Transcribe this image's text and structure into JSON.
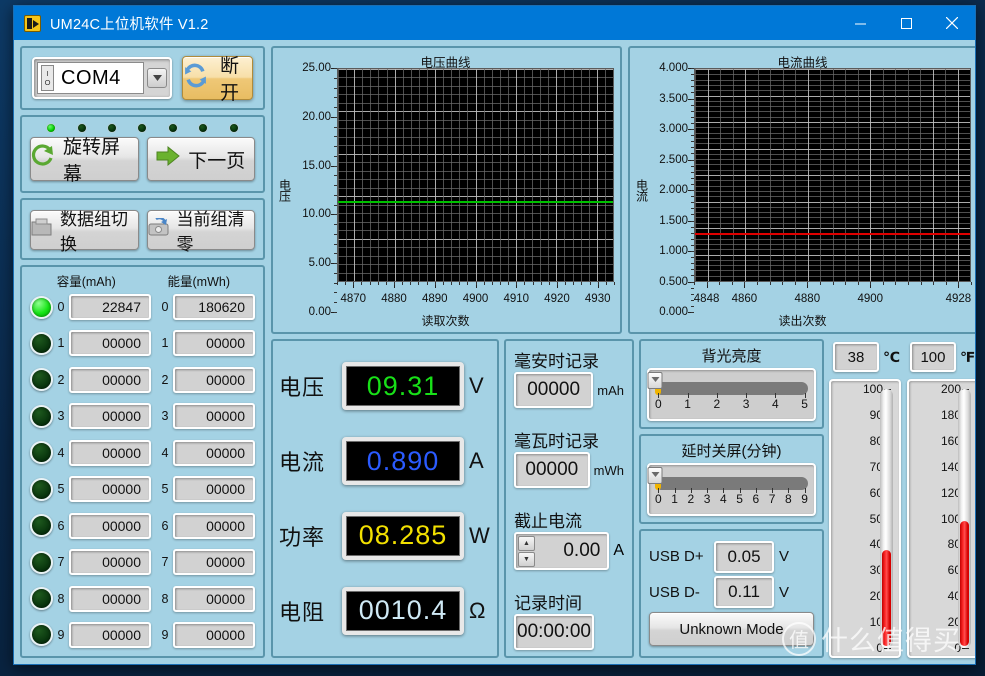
{
  "window": {
    "title": "UM24C上位机软件 V1.2",
    "icon": "labview-vi-icon",
    "minimize": "–",
    "maximize": "□",
    "close": "✕"
  },
  "connection": {
    "port_value": "COM4",
    "port_icon": "io-refnum-icon",
    "dropdown_icon": "chevron-down-icon",
    "disconnect_label": "断开",
    "disconnect_icon": "refresh-icon"
  },
  "leds": {
    "states": [
      "on",
      "off",
      "off",
      "off",
      "off",
      "off",
      "off"
    ]
  },
  "nav": {
    "rotate_label": "旋转屏幕",
    "rotate_icon": "rotate-icon",
    "next_label": "下一页",
    "next_icon": "arrow-right-icon"
  },
  "group": {
    "switch_label": "数据组切换",
    "switch_icon": "folder-icon",
    "clear_label": "当前组清零",
    "clear_icon": "save-clear-icon"
  },
  "list": {
    "header_capacity": "容量(mAh)",
    "header_energy": "能量(mWh)",
    "rows": [
      {
        "index": "0",
        "led": "on",
        "capacity": "22847",
        "energy": "180620"
      },
      {
        "index": "1",
        "led": "off",
        "capacity": "00000",
        "energy": "00000"
      },
      {
        "index": "2",
        "led": "off",
        "capacity": "00000",
        "energy": "00000"
      },
      {
        "index": "3",
        "led": "off",
        "capacity": "00000",
        "energy": "00000"
      },
      {
        "index": "4",
        "led": "off",
        "capacity": "00000",
        "energy": "00000"
      },
      {
        "index": "5",
        "led": "off",
        "capacity": "00000",
        "energy": "00000"
      },
      {
        "index": "6",
        "led": "off",
        "capacity": "00000",
        "energy": "00000"
      },
      {
        "index": "7",
        "led": "off",
        "capacity": "00000",
        "energy": "00000"
      },
      {
        "index": "8",
        "led": "off",
        "capacity": "00000",
        "energy": "00000"
      },
      {
        "index": "9",
        "led": "off",
        "capacity": "00000",
        "energy": "00000"
      }
    ]
  },
  "chart_data": [
    {
      "type": "line",
      "id": "voltage",
      "title": "电压曲线",
      "xlabel": "读取次数",
      "ylabel": "电压",
      "ylim": [
        0,
        25
      ],
      "yticks": [
        "0.00",
        "5.00",
        "10.00",
        "15.00",
        "20.00",
        "25.00"
      ],
      "ytick_values": [
        0,
        5,
        10,
        15,
        20,
        25
      ],
      "xlim": [
        4866,
        4934
      ],
      "xticks": [
        "4870",
        "4880",
        "4890",
        "4900",
        "4910",
        "4920",
        "4930"
      ],
      "xtick_values": [
        4870,
        4880,
        4890,
        4900,
        4910,
        4920,
        4930
      ],
      "grid": true,
      "series": [
        {
          "name": "电压",
          "color": "#00c000",
          "constant_value": 9.31
        }
      ]
    },
    {
      "type": "line",
      "id": "current",
      "title": "电流曲线",
      "xlabel": "读出次数",
      "ylabel": "电流",
      "ylim": [
        0,
        4
      ],
      "yticks": [
        "0.000",
        "0.500",
        "1.000",
        "1.500",
        "2.000",
        "2.500",
        "3.000",
        "3.500",
        "4.000"
      ],
      "ytick_values": [
        0,
        0.5,
        1.0,
        1.5,
        2.0,
        2.5,
        3.0,
        3.5,
        4.0
      ],
      "xlim": [
        4844,
        4932
      ],
      "xticks": [
        "4848",
        "4860",
        "4880",
        "4900",
        "4928"
      ],
      "xtick_values": [
        4848,
        4860,
        4880,
        4900,
        4928
      ],
      "grid": true,
      "series": [
        {
          "name": "电流",
          "color": "#e00000",
          "constant_value": 0.89
        }
      ]
    }
  ],
  "meters": [
    {
      "label": "电压",
      "value": "09.31",
      "unit": "V",
      "color": "#18e018"
    },
    {
      "label": "电流",
      "value": "0.890",
      "unit": "A",
      "color": "#2b5bff"
    },
    {
      "label": "功率",
      "value": "08.285",
      "unit": "W",
      "color": "#f2e000"
    },
    {
      "label": "电阻",
      "value": "0010.4",
      "unit": "Ω",
      "color": "#cfe9f5"
    }
  ],
  "records": {
    "mah_title": "毫安时记录",
    "mah_value": "00000",
    "mah_unit": "mAh",
    "mwh_title": "毫瓦时记录",
    "mwh_value": "00000",
    "mwh_unit": "mWh",
    "cutoff_title": "截止电流",
    "cutoff_value": "0.00",
    "cutoff_unit": "A",
    "cutoff_up_icon": "spinner-up-icon",
    "cutoff_down_icon": "spinner-down-icon",
    "time_title": "记录时间",
    "time_value": "00:00:00"
  },
  "controls": {
    "backlight_title": "背光亮度",
    "backlight_value": 0,
    "backlight_ticks": [
      "0",
      "1",
      "2",
      "3",
      "4",
      "5"
    ],
    "screensaver_title": "延时关屏(分钟)",
    "screensaver_value": 0,
    "screensaver_ticks": [
      "0",
      "1",
      "2",
      "3",
      "4",
      "5",
      "6",
      "7",
      "8",
      "9"
    ],
    "usb_dp_label": "USB D+",
    "usb_dp_value": "0.05",
    "usb_dp_unit": "V",
    "usb_dn_label": "USB D-",
    "usb_dn_value": "0.11",
    "usb_dn_unit": "V",
    "mode_label": "Unknown Mode"
  },
  "temperature": {
    "celsius_value": "38",
    "celsius_unit": "℃",
    "fahrenheit_value": "100",
    "fahrenheit_unit": "℉",
    "celsius_scale": [
      "100",
      "90",
      "80",
      "70",
      "60",
      "50",
      "40",
      "30",
      "20",
      "10",
      "0"
    ],
    "celsius_range": [
      0,
      100
    ],
    "celsius_reading": 38,
    "fahrenheit_scale": [
      "200",
      "180",
      "160",
      "140",
      "120",
      "100",
      "80",
      "60",
      "40",
      "20",
      "0"
    ],
    "fahrenheit_range": [
      0,
      200
    ],
    "fahrenheit_reading": 100
  },
  "watermark": {
    "logo": "值",
    "text": "什么值得买"
  }
}
